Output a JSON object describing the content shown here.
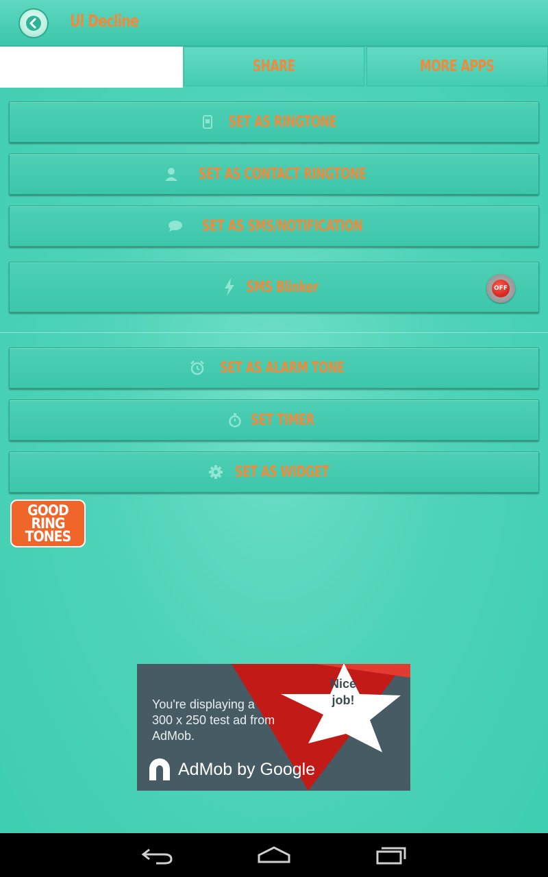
{
  "header": {
    "title": "Ul Decline"
  },
  "tabs": [
    {
      "label": ""
    },
    {
      "label": "SHARE"
    },
    {
      "label": "MORE APPS"
    }
  ],
  "actions": {
    "ringtone": "SET AS RINGTONE",
    "contact": "SET AS CONTACT RINGTONE",
    "sms": "SET AS SMS/NOTIFICATION",
    "blinker": "SMS Blinker",
    "blinker_state": "OFF",
    "alarm": "SET AS ALARM TONE",
    "timer": "SET TIMER",
    "widget": "SET AS WIDGET"
  },
  "logo": {
    "line1": "GOOD",
    "line2": "RING",
    "line3": "TONES"
  },
  "ad": {
    "text": "You're displaying a 300 x 250 test ad from AdMob.",
    "brand": "AdMob by Google",
    "badge_line1": "Nice",
    "badge_line2": "job!"
  },
  "colors": {
    "accent": "#f08a3a",
    "teal": "#4ed0b5",
    "ad_bg": "#465b63"
  }
}
